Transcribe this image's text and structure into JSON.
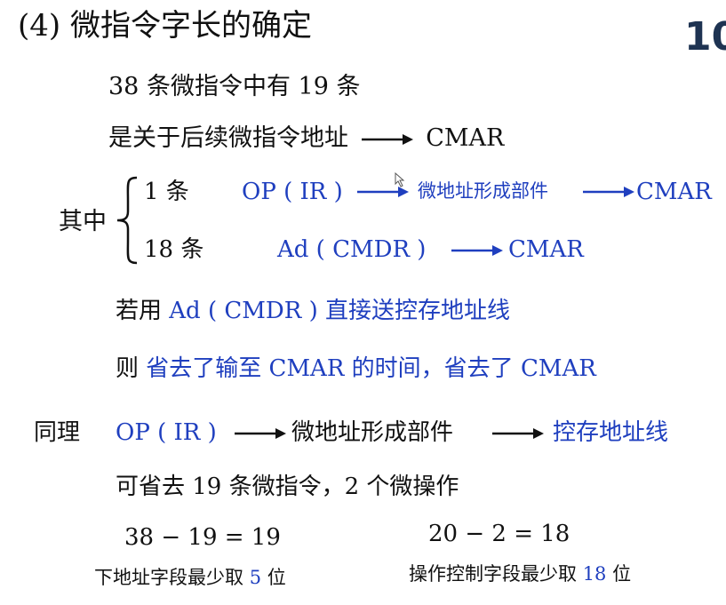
{
  "title": "(4)  微指令字长的确定",
  "page_number": "10",
  "line1": "38 条微指令中有 19 条",
  "line2_text": "是关于后续微指令地址",
  "line2_target": "CMAR",
  "qizhong": "其中",
  "row1": {
    "count": "1 条",
    "src": "OP ( IR )",
    "mid": "微地址形成部件",
    "dst": "CMAR"
  },
  "row2": {
    "count": "18 条",
    "src": "Ad ( CMDR )",
    "dst": "CMAR"
  },
  "line_ruo": {
    "prefix": "若用",
    "src": "Ad ( CMDR )",
    "rest": "直接送控存地址线"
  },
  "line_ze": {
    "prefix": "则",
    "rest": "省去了输至 CMAR 的时间，省去了 CMAR"
  },
  "line_tongli": {
    "prefix": "同理",
    "src": "OP ( IR )",
    "mid": "微地址形成部件",
    "dst": "控存地址线"
  },
  "line_kesheng": "可省去 19 条微指令，2 个微操作",
  "calc_left": "38 − 19 = 19",
  "calc_right": "20 − 2 = 18",
  "bottom_left": {
    "text": "下地址字段最少取",
    "num": "5",
    "unit": "位"
  },
  "bottom_right": {
    "text": "操作控制字段最少取",
    "num": "18",
    "unit": "位"
  }
}
